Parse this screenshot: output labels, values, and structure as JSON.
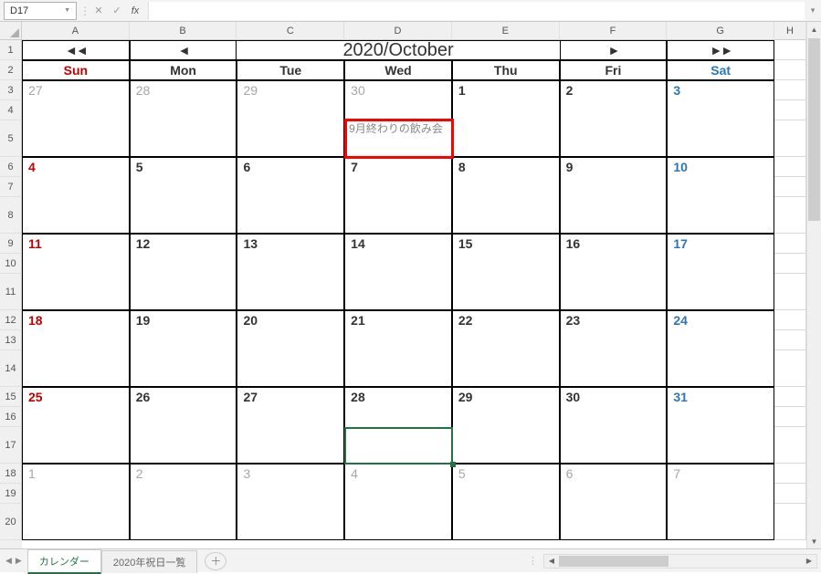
{
  "name_box": "D17",
  "formula": "",
  "columns": [
    "A",
    "B",
    "C",
    "D",
    "E",
    "F",
    "G",
    "H"
  ],
  "rows": [
    "1",
    "2",
    "3",
    "4",
    "5",
    "6",
    "7",
    "8",
    "9",
    "10",
    "11",
    "12",
    "13",
    "14",
    "15",
    "16",
    "17",
    "18",
    "19",
    "20"
  ],
  "nav": {
    "first": "◄◄",
    "prev": "◄",
    "next": "►",
    "last": "►►"
  },
  "title": "2020/October",
  "dow": {
    "sun": "Sun",
    "mon": "Mon",
    "tue": "Tue",
    "wed": "Wed",
    "thu": "Thu",
    "fri": "Fri",
    "sat": "Sat"
  },
  "weeks": [
    {
      "days": [
        "27",
        "28",
        "29",
        "30",
        "1",
        "2",
        "3"
      ],
      "gray": [
        0,
        1,
        2,
        3
      ],
      "events": [
        "",
        "",
        "",
        "9月終わりの飲み会",
        "",
        "",
        ""
      ]
    },
    {
      "days": [
        "4",
        "5",
        "6",
        "7",
        "8",
        "9",
        "10"
      ],
      "gray": [],
      "events": [
        "",
        "",
        "",
        "",
        "",
        "",
        ""
      ]
    },
    {
      "days": [
        "11",
        "12",
        "13",
        "14",
        "15",
        "16",
        "17"
      ],
      "gray": [],
      "events": [
        "",
        "",
        "",
        "",
        "",
        "",
        ""
      ]
    },
    {
      "days": [
        "18",
        "19",
        "20",
        "21",
        "22",
        "23",
        "24"
      ],
      "gray": [],
      "events": [
        "",
        "",
        "",
        "",
        "",
        "",
        ""
      ]
    },
    {
      "days": [
        "25",
        "26",
        "27",
        "28",
        "29",
        "30",
        "31"
      ],
      "gray": [],
      "events": [
        "",
        "",
        "",
        "",
        "",
        "",
        ""
      ]
    },
    {
      "days": [
        "1",
        "2",
        "3",
        "4",
        "5",
        "6",
        "7"
      ],
      "gray": [
        0,
        1,
        2,
        3,
        4,
        5,
        6
      ],
      "events": [
        "",
        "",
        "",
        "",
        "",
        "",
        ""
      ]
    }
  ],
  "tabs": {
    "active": "カレンダー",
    "other": "2020年祝日一覧"
  }
}
